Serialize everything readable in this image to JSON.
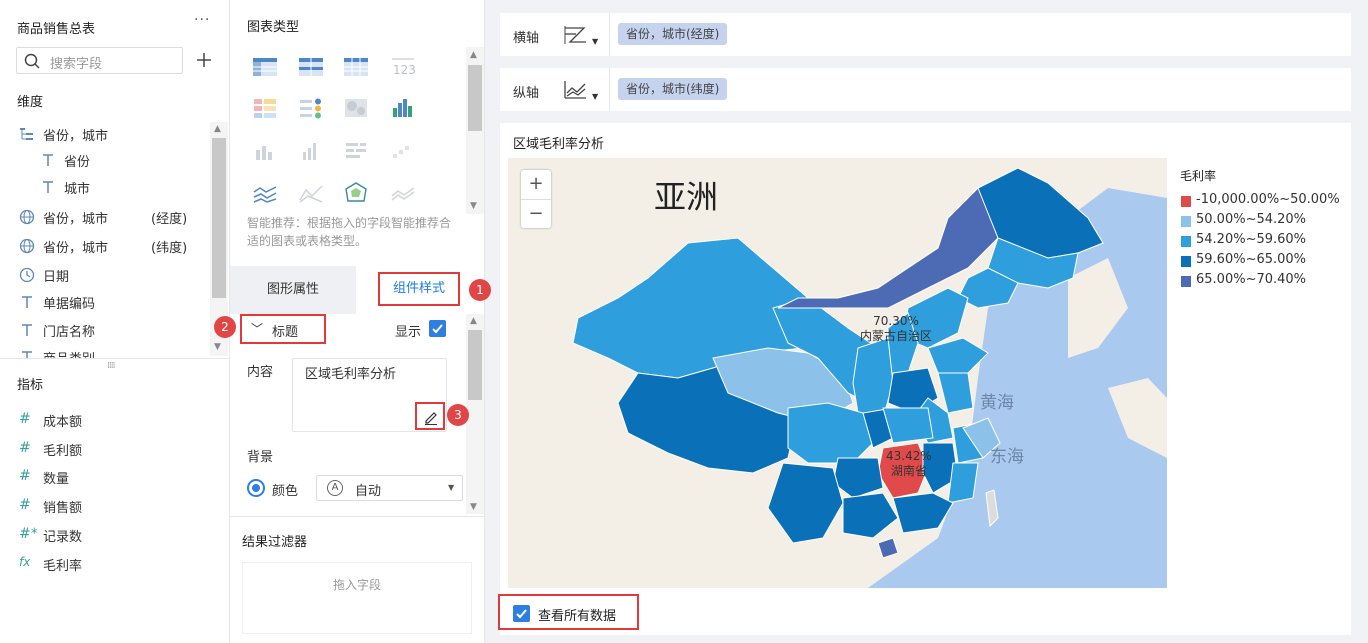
{
  "dataset": {
    "title": "商品销售总表",
    "more": "···",
    "search_placeholder": "搜索字段"
  },
  "dimensions": {
    "label": "维度",
    "items": [
      {
        "icon": "hierarchy-icon",
        "label": "省份，城市",
        "suffix": ""
      },
      {
        "icon": "text-type-icon",
        "label": "省份",
        "suffix": ""
      },
      {
        "icon": "text-type-icon",
        "label": "城市",
        "suffix": ""
      },
      {
        "icon": "globe-icon",
        "label": "省份，城市",
        "suffix": "(经度)"
      },
      {
        "icon": "globe-icon",
        "label": "省份，城市",
        "suffix": "(纬度)"
      },
      {
        "icon": "clock-icon",
        "label": "日期",
        "suffix": ""
      },
      {
        "icon": "text-type-icon",
        "label": "单据编码",
        "suffix": ""
      },
      {
        "icon": "text-type-icon",
        "label": "门店名称",
        "suffix": ""
      },
      {
        "icon": "text-type-icon",
        "label": "商品类别",
        "suffix": ""
      }
    ]
  },
  "indicators": {
    "label": "指标",
    "items": [
      {
        "icon": "#",
        "label": "成本额"
      },
      {
        "icon": "#",
        "label": "毛利额"
      },
      {
        "icon": "#",
        "label": "数量"
      },
      {
        "icon": "#",
        "label": "销售额"
      },
      {
        "icon": "#*",
        "label": "记录数"
      },
      {
        "icon": "fx",
        "label": "毛利率"
      }
    ]
  },
  "chart_types": {
    "title": "图表类型",
    "tip": "智能推荐：根据拖入的字段智能推荐合适的图表或表格类型。"
  },
  "tabs": {
    "shape_label": "图形属性",
    "component_label": "组件样式"
  },
  "badges": [
    "1",
    "2",
    "3"
  ],
  "title_section": {
    "label": "标题",
    "show_label": "显示",
    "content_label": "内容",
    "content_value": "区域毛利率分析",
    "background_label": "背景",
    "color_label": "颜色",
    "color_value": "自动"
  },
  "filter": {
    "title": "结果过滤器",
    "placeholder": "拖入字段"
  },
  "axes": {
    "x_label": "横轴",
    "x_field": "省份，城市(经度)",
    "y_label": "纵轴",
    "y_field": "省份，城市(纬度)"
  },
  "chart": {
    "title": "区域毛利率分析",
    "zoom_in": "+",
    "zoom_out": "−",
    "continent_label": "亚洲",
    "sea_labels": [
      "黄海",
      "东海"
    ],
    "region_labels": [
      {
        "value": "70.30%",
        "name": "内蒙古自治区"
      },
      {
        "value": "43.42%",
        "name": "湖南省"
      }
    ],
    "view_all_label": "查看所有数据"
  },
  "legend": {
    "title": "毛利率",
    "items": [
      {
        "label": "-10,000.00%~50.00%",
        "color": "#e04a4a"
      },
      {
        "label": "50.00%~54.20%",
        "color": "#8cc2ea"
      },
      {
        "label": "54.20%~59.60%",
        "color": "#2e9fdc"
      },
      {
        "label": "59.60%~65.00%",
        "color": "#0a71b8"
      },
      {
        "label": "65.00%~70.40%",
        "color": "#4d6bb4"
      }
    ]
  }
}
